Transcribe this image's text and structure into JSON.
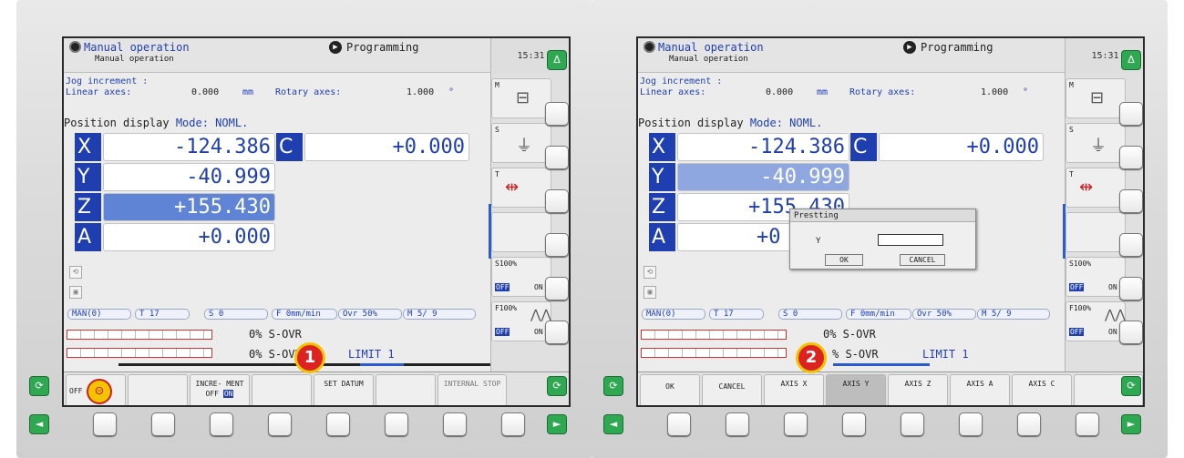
{
  "panels": [
    {
      "header": {
        "mode": "Manual operation",
        "submode": "Manual operation",
        "program": "Programming",
        "time": "15:31"
      },
      "jog": {
        "title": "Jog increment :",
        "linear_label": "Linear axes:",
        "linear_value": "0.000",
        "linear_unit": "mm",
        "rotary_label": "Rotary axes:",
        "rotary_value": "1.000",
        "rotary_unit": "°"
      },
      "position": {
        "label": "Position display",
        "mode": "Mode: NOML."
      },
      "axes": [
        {
          "name": "X",
          "value": "-124.386"
        },
        {
          "name": "Y",
          "value": "-40.999"
        },
        {
          "name": "Z",
          "value": "+155.430"
        },
        {
          "name": "A",
          "value": "+0.000"
        },
        {
          "name": "C",
          "value": "+0.000"
        }
      ],
      "status": {
        "man": "MAN(0)",
        "tool": "T 17",
        "spindle": "S 0",
        "feed": "F 0mm/min",
        "ovr": "Ovr  50%",
        "m": "M 5/ 9"
      },
      "override": {
        "row1": "0%  S-OVR",
        "row2": "0%  S-OVR",
        "limit": "LIMIT 1"
      },
      "side_softkeys": [
        "M",
        "S",
        "T",
        "",
        "S100%",
        "F100%"
      ],
      "side_sub": {
        "off": "OFF",
        "on": "ON"
      },
      "softkeys": [
        "OFF",
        "",
        "INCRE- MENT",
        "",
        "SET DATUM",
        "",
        "INTERNAL STOP"
      ],
      "inc_off": "OFF",
      "inc_on": "ON",
      "badge": "1"
    },
    {
      "header": {
        "mode": "Manual operation",
        "submode": "Manual operation",
        "program": "Programming",
        "time": "15:31"
      },
      "jog": {
        "title": "Jog increment :",
        "linear_label": "Linear axes:",
        "linear_value": "0.000",
        "linear_unit": "mm",
        "rotary_label": "Rotary axes:",
        "rotary_value": "1.000",
        "rotary_unit": "°"
      },
      "position": {
        "label": "Position display",
        "mode": "Mode: NOML."
      },
      "axes": [
        {
          "name": "X",
          "value": "-124.386"
        },
        {
          "name": "Y",
          "value": "-40.999"
        },
        {
          "name": "Z",
          "value": "+155.430"
        },
        {
          "name": "A",
          "value": "+0"
        },
        {
          "name": "C",
          "value": "+0.000"
        }
      ],
      "status": {
        "man": "MAN(0)",
        "tool": "T 17",
        "spindle": "S 0",
        "feed": "F 0mm/min",
        "ovr": "Ovr  50%",
        "m": "M 5/ 9"
      },
      "override": {
        "row1": "0%  S-OVR",
        "row2": "%  S-OVR",
        "limit": "LIMIT 1"
      },
      "side_softkeys": [
        "M",
        "S",
        "T",
        "",
        "S100%",
        "F100%"
      ],
      "side_sub": {
        "off": "OFF",
        "on": "ON"
      },
      "dialog": {
        "title": "Prestting",
        "field_label": "Y",
        "field_value": "",
        "ok": "OK",
        "cancel": "CANCEL"
      },
      "softkeys": [
        "OK",
        "CANCEL",
        "AXIS X",
        "AXIS Y",
        "AXIS Z",
        "AXIS A",
        "AXIS C",
        ""
      ],
      "badge": "2"
    }
  ],
  "hw": {
    "up_arrow": "Δ",
    "left_arrow": "◄",
    "right_arrow": "►",
    "cycle": "⟳"
  }
}
